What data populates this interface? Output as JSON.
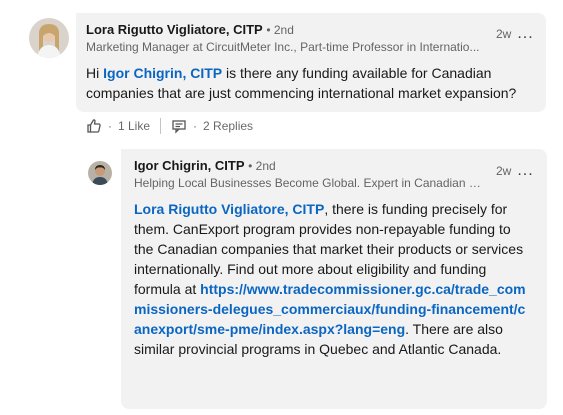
{
  "comment1": {
    "author": "Lora Rigutto Vigliatore, CITP",
    "degree": "• 2nd",
    "headline": "Marketing Manager at CircuitMeter Inc., Part-time Professor in Internatio...",
    "time": "2w",
    "more": "...",
    "mention": "Igor Chigrin, CITP",
    "text_before": "Hi ",
    "text_after": " is there any funding available for Canadian companies that are just commencing international market expansion?",
    "likes": "1 Like",
    "replies": "2 Replies",
    "dot": "·"
  },
  "reply1": {
    "author": "Igor Chigrin, CITP",
    "degree": "• 2nd",
    "headline": "Helping Local Businesses Become Global. Expert in Canadian Go...",
    "time": "2w",
    "more": "...",
    "mention": "Lora Rigutto Vigliatore, CITP",
    "text1": ", there is funding precisely for them. CanExport program provides non-repayable funding to the Canadian companies that market their products or services internationally. Find out more about eligibility and funding formula at ",
    "link": "https://www.tradecommissioner.gc.ca/trade_commissioners-delegues_commerciaux/funding-financement/canexport/sme-pme/index.aspx?lang=eng",
    "text2": ". There are also similar provincial programs in Quebec and Atlantic Canada."
  },
  "icons": {
    "like": "like-thumb-icon",
    "reply": "reply-comment-icon"
  },
  "colors": {
    "accent": "#0a66c2",
    "bubble": "#f2f2f2"
  }
}
